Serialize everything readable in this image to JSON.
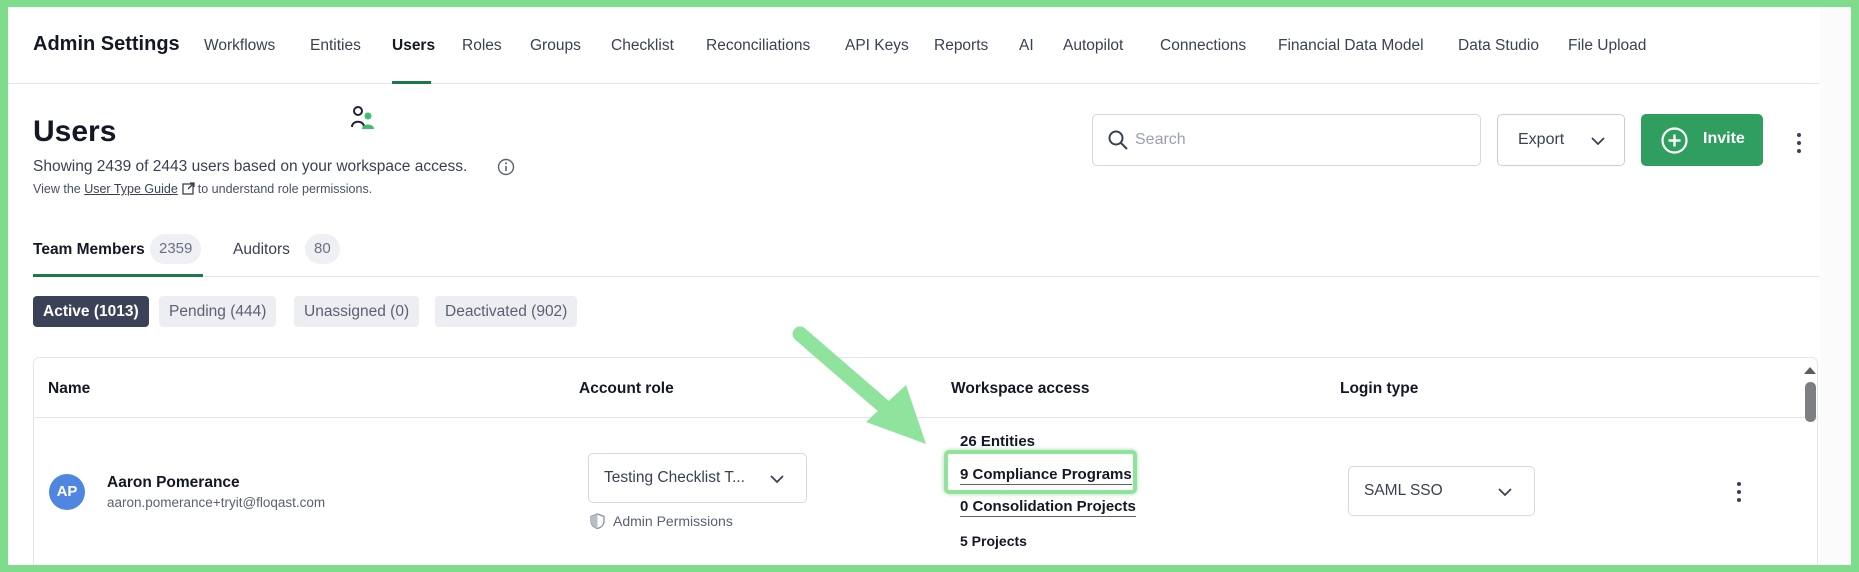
{
  "app": {
    "title": "Admin Settings"
  },
  "nav": {
    "items": [
      {
        "label": "Workflows"
      },
      {
        "label": "Entities"
      },
      {
        "label": "Users"
      },
      {
        "label": "Roles"
      },
      {
        "label": "Groups"
      },
      {
        "label": "Checklist"
      },
      {
        "label": "Reconciliations"
      },
      {
        "label": "API Keys"
      },
      {
        "label": "Reports"
      },
      {
        "label": "AI"
      },
      {
        "label": "Autopilot"
      },
      {
        "label": "Connections"
      },
      {
        "label": "Financial Data Model"
      },
      {
        "label": "Data Studio"
      },
      {
        "label": "File Upload"
      }
    ],
    "active": "Users"
  },
  "header": {
    "title": "Users",
    "subtitle": "Showing 2439 of 2443 users based on your workspace access.",
    "guide_prefix": "View the",
    "guide_link": "User Type Guide",
    "guide_suffix": "to understand role permissions."
  },
  "search": {
    "placeholder": "Search",
    "value": ""
  },
  "actions": {
    "export_label": "Export",
    "invite_label": "Invite"
  },
  "tabs": [
    {
      "label": "Team Members",
      "count": "2359"
    },
    {
      "label": "Auditors",
      "count": "80"
    }
  ],
  "filters": [
    {
      "label": "Active (1013)"
    },
    {
      "label": "Pending (444)"
    },
    {
      "label": "Unassigned (0)"
    },
    {
      "label": "Deactivated (902)"
    }
  ],
  "table": {
    "columns": [
      "Name",
      "Account role",
      "Workspace access",
      "Login type"
    ],
    "rows": [
      {
        "initials": "AP",
        "name": "Aaron Pomerance",
        "email": "aaron.pomerance+tryit@floqast.com",
        "role": "Testing Checklist T...",
        "permissions": "Admin Permissions",
        "access": [
          "26 Entities",
          "9 Compliance Programs",
          "0 Consolidation Projects",
          "5 Projects"
        ],
        "login_type": "SAML SSO"
      }
    ]
  },
  "colors": {
    "accent_green": "#2f9e5e",
    "nav_underline": "#1c7a4a",
    "active_chip": "#3b4257",
    "avatar": "#4f86e0",
    "annotation": "#8fe39d",
    "frame": "#7fdc8c"
  },
  "icons": {
    "users": "users-icon",
    "info": "info-icon",
    "external": "external-link-icon",
    "search": "search-icon",
    "chevron": "chevron-down-icon",
    "plus": "plus-circle-icon",
    "kebab": "more-vertical-icon",
    "shield": "shield-icon"
  }
}
